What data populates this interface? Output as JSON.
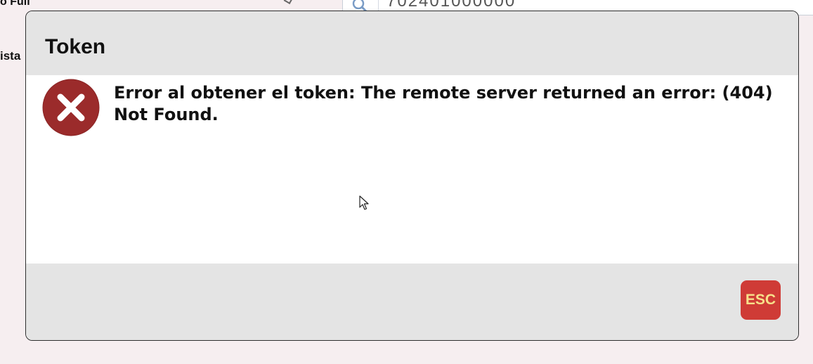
{
  "background": {
    "top_label": "o Full",
    "side_label": "ista",
    "search": {
      "icon": "search-icon",
      "value": "702401000000"
    }
  },
  "dialog": {
    "title": "Token",
    "icon": "error-circle-x-icon",
    "message": "Error al obtener el token: The remote server returned an error: (404) Not Found.",
    "esc_label": "ESC"
  },
  "colors": {
    "error_red": "#9b2b2b",
    "esc_red": "#cf3b36",
    "esc_text": "#f7e08a",
    "header_gray": "#e4e4e4",
    "body_white": "#ffffff",
    "page_bg": "#f6eef0"
  }
}
